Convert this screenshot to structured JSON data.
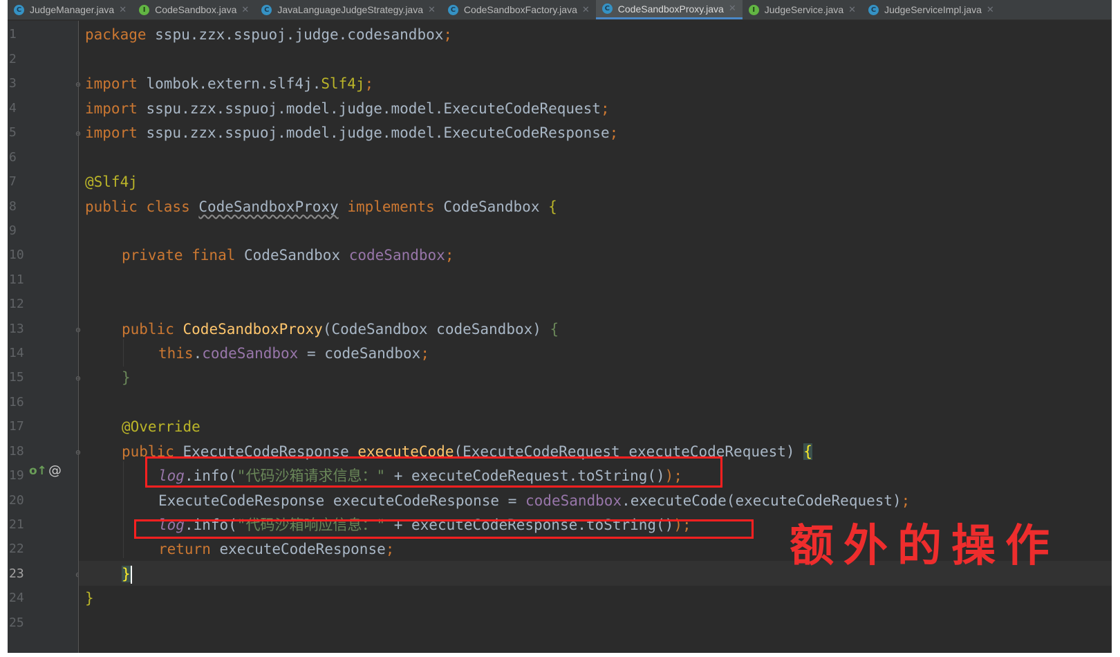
{
  "tabs": [
    {
      "label": "JudgeManager.java",
      "icon": "class",
      "active": false
    },
    {
      "label": "CodeSandbox.java",
      "icon": "interface",
      "active": false
    },
    {
      "label": "JavaLanguageJudgeStrategy.java",
      "icon": "class",
      "active": false
    },
    {
      "label": "CodeSandboxFactory.java",
      "icon": "class",
      "active": false
    },
    {
      "label": "CodeSandboxProxy.java",
      "icon": "class",
      "active": true
    },
    {
      "label": "JudgeService.java",
      "icon": "interface",
      "active": false
    },
    {
      "label": "JudgeServiceImpl.java",
      "icon": "class",
      "active": false
    }
  ],
  "editor": {
    "current_line": 23,
    "line_numbers": [
      "1",
      "2",
      "3",
      "4",
      "5",
      "6",
      "7",
      "8",
      "9",
      "10",
      "11",
      "12",
      "13",
      "14",
      "15",
      "16",
      "17",
      "18",
      "19",
      "20",
      "21",
      "22",
      "23",
      "24",
      "25"
    ],
    "gutter_icons": {
      "override": "o↑",
      "annotation": "@"
    },
    "code": {
      "l1_package": "package",
      "l1_path": " sspu.zzx.sspuoj.judge.codesandbox",
      "l3_import": "import",
      "l3_path": " lombok.extern.slf4j.",
      "l3_ann": "Slf4j",
      "l4_import": "import",
      "l4_path": " sspu.zzx.sspuoj.model.judge.model.ExecuteCodeRequest",
      "l5_import": "import",
      "l5_path": " sspu.zzx.sspuoj.model.judge.model.ExecuteCodeResponse",
      "semi": ";",
      "l7_ann": "@Slf4j",
      "l8_kw": "public class ",
      "l8_class": "CodeSandboxProxy",
      "l8_impl": " implements ",
      "l8_iface": "CodeSandbox ",
      "l8_brace": "{",
      "l10_kw": "private final ",
      "l10_type": "CodeSandbox ",
      "l10_field": "codeSandbox",
      "l13_kw": "public ",
      "l13_method": "CodeSandboxProxy",
      "l13_params": "(CodeSandbox codeSandbox) ",
      "l13_brace": "{",
      "l14_this": "this",
      "l14_dot": ".",
      "l14_field": "codeSandbox",
      "l14_rest": " = codeSandbox",
      "l15_brace": "}",
      "l17_ann": "@Override",
      "l18_kw": "public ",
      "l18_type": "ExecuteCodeResponse ",
      "l18_method": "executeCode",
      "l18_params": "(ExecuteCodeRequest executeCodeRequest) ",
      "l18_brace": "{",
      "l19_log": "log",
      "l19_call": ".info(",
      "l19_str": "\"代码沙箱请求信息：\"",
      "l19_rest": " + executeCodeRequest.toString()",
      "l19_end": ");",
      "l20_a": "ExecuteCodeResponse executeCodeResponse = ",
      "l20_field": "codeSandbox",
      "l20_b": ".executeCode(executeCodeRequest)",
      "l21_log": "log",
      "l21_call": ".info(",
      "l21_str": "\"代码沙箱响应信息：\"",
      "l21_rest": " + executeCodeResponse.toString()",
      "l21_end": ");",
      "l22_kw": "return ",
      "l22_rest": "executeCodeResponse",
      "l23_brace": "}",
      "l24_brace": "}"
    }
  },
  "annotation_note": "额外的操作",
  "colors": {
    "highlight_box": "#ff2020",
    "note_text": "#ee2d2d",
    "active_tab_underline": "#4a88c7"
  }
}
